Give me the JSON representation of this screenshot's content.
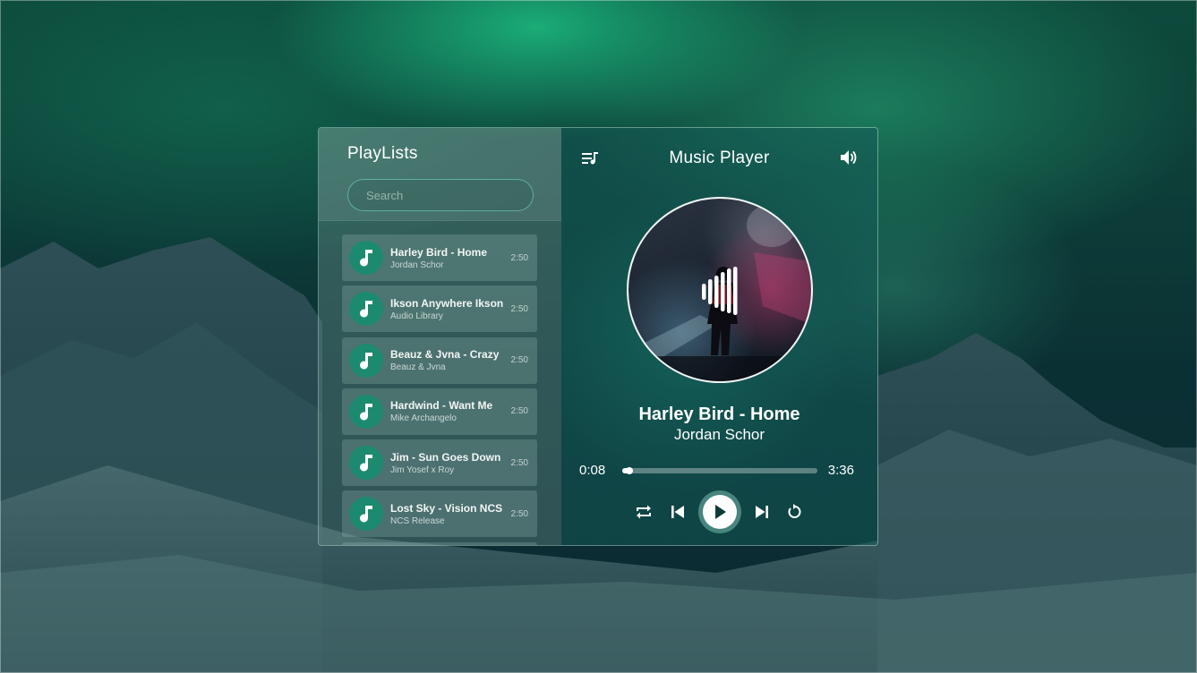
{
  "playlists": {
    "title": "PlayLists",
    "search_placeholder": "Search",
    "tracks": [
      {
        "title": "Harley Bird - Home",
        "artist": "Jordan Schor",
        "duration": "2:50"
      },
      {
        "title": "Ikson Anywhere Ikson",
        "artist": "Audio Library",
        "duration": "2:50"
      },
      {
        "title": "Beauz & Jvna - Crazy",
        "artist": "Beauz & Jvna",
        "duration": "2:50"
      },
      {
        "title": "Hardwind - Want Me",
        "artist": "Mike Archangelo",
        "duration": "2:50"
      },
      {
        "title": "Jim - Sun Goes Down",
        "artist": "Jim Yosef x Roy",
        "duration": "2:50"
      },
      {
        "title": "Lost Sky - Vision NCS",
        "artist": "NCS Release",
        "duration": "2:50"
      }
    ]
  },
  "player": {
    "title": "Music Player",
    "now_playing": {
      "title": "Harley Bird - Home",
      "artist": "Jordan Schor"
    },
    "current_time": "0:08",
    "total_time": "3:36",
    "progress_fraction": 0.037
  },
  "icons": {
    "queue": "queue-music-icon",
    "volume": "volume-icon",
    "search": "search-icon",
    "track": "music-note-icon",
    "repeat": "repeat-icon",
    "previous": "skip-previous-icon",
    "play": "play-icon",
    "next": "skip-next-icon",
    "replay": "replay-icon",
    "equalizer": "equalizer-bars-icon"
  },
  "colors": {
    "accent": "#1c8a6e",
    "text": "#ffffff"
  }
}
